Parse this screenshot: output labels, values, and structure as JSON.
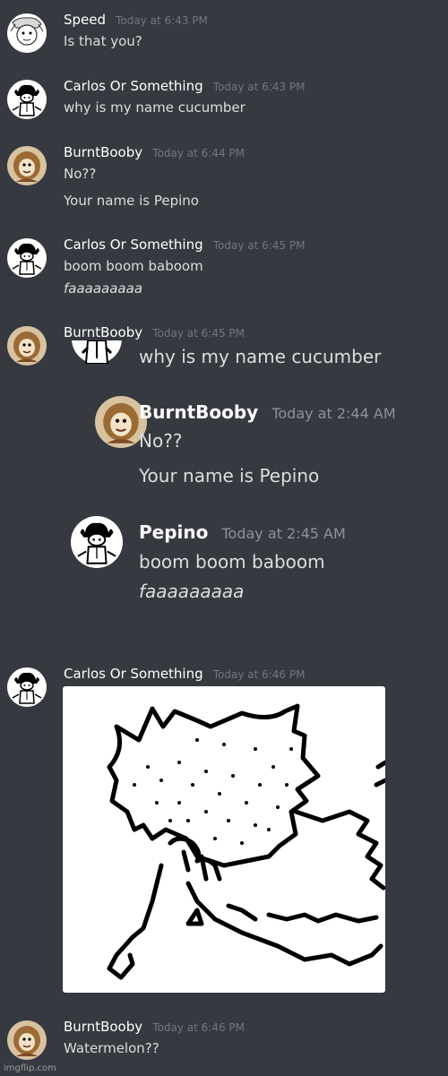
{
  "messages": [
    {
      "author": "Speed",
      "timestamp": "Today at 6:43 PM",
      "lines": [
        "Is that you?"
      ]
    },
    {
      "author": "Carlos Or Something",
      "timestamp": "Today at 6:43 PM",
      "lines": [
        "why is my name cucumber"
      ]
    },
    {
      "author": "BurntBooby",
      "timestamp": "Today at 6:44 PM",
      "lines": [
        "No??",
        "Your name is Pepino"
      ]
    },
    {
      "author": "Carlos Or Something",
      "timestamp": "Today at 6:45 PM",
      "lines": [
        "boom boom baboom",
        "faaaaaaaaa"
      ]
    },
    {
      "author": "BurntBooby",
      "timestamp": "Today at 6:45 PM",
      "lines": []
    },
    {
      "author": "Carlos Or Something",
      "timestamp": "Today at 6:46 PM",
      "lines": []
    },
    {
      "author": "BurntBooby",
      "timestamp": "Today at 6:46 PM",
      "lines": [
        "Watermelon??"
      ]
    }
  ],
  "embedded_screenshot": {
    "top_line": "why is my name cucumber",
    "messages": [
      {
        "author": "BurntBooby",
        "timestamp": "Today at 2:44 AM",
        "lines": [
          "No??",
          "Your name is Pepino"
        ]
      },
      {
        "author": "Pepino",
        "timestamp": "Today at 2:45 AM",
        "lines": [
          "boom boom baboom",
          "faaaaaaaaa"
        ]
      }
    ]
  },
  "watermark": "imgflip.com",
  "colors": {
    "background": "#36393f",
    "username": "#ffffff",
    "timestamp": "#72767d",
    "text": "#dcddde"
  }
}
